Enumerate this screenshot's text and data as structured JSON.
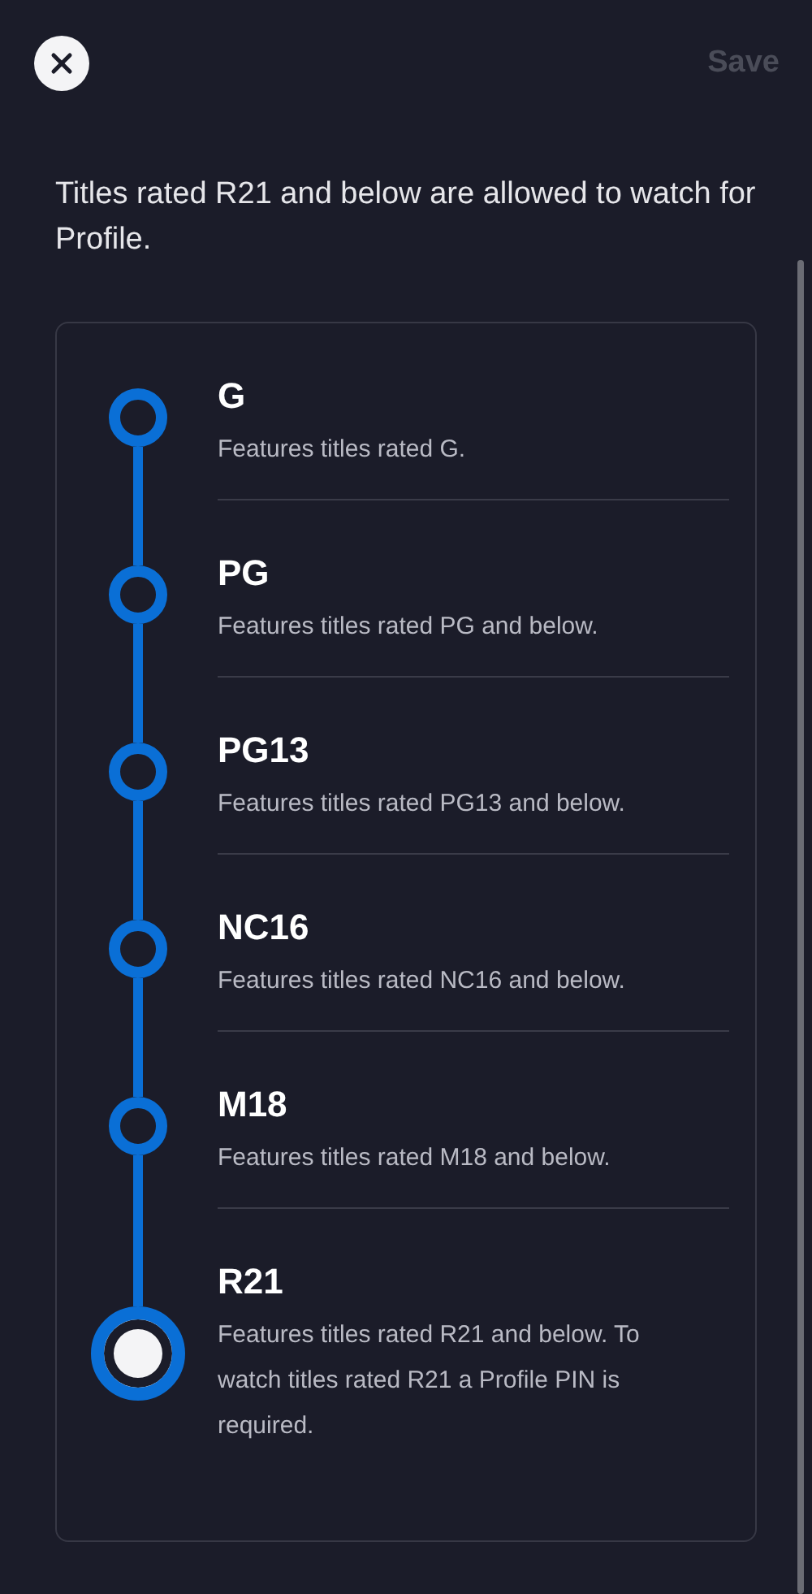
{
  "header": {
    "save_label": "Save",
    "save_disabled": true
  },
  "description": "Titles rated R21 and below are allowed to watch for Profile.",
  "ratings": [
    {
      "title": "G",
      "description": "Features titles rated G.",
      "selected": false
    },
    {
      "title": "PG",
      "description": "Features titles rated PG and below.",
      "selected": false
    },
    {
      "title": "PG13",
      "description": "Features titles rated PG13 and below.",
      "selected": false
    },
    {
      "title": "NC16",
      "description": "Features titles rated NC16 and below.",
      "selected": false
    },
    {
      "title": "M18",
      "description": "Features titles rated M18 and below.",
      "selected": false
    },
    {
      "title": "R21",
      "description": "Features titles rated R21 and below. To watch titles rated R21 a Profile PIN is required.",
      "selected": true
    }
  ]
}
